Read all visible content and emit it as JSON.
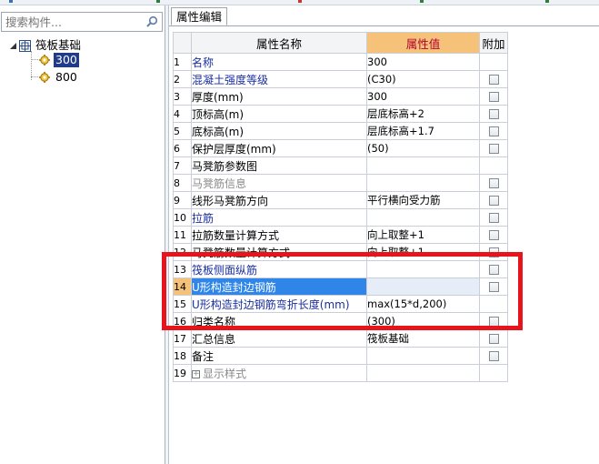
{
  "colors": {
    "value_header_bg": "#f6c27a",
    "value_header_text": "#b1002c",
    "name_blue": "#1a2f9e",
    "name_gray": "#8a8a8a",
    "selection": "#2f86e8",
    "tree_selection": "#1f3b8a",
    "highlight_frame": "#e8141b"
  },
  "search": {
    "placeholder": "搜索构件..."
  },
  "tree": {
    "root": {
      "label": "筏板基础",
      "icon": "grid-icon",
      "expanded": true
    },
    "children": [
      {
        "label": "300",
        "icon": "gear-icon",
        "selected": true
      },
      {
        "label": "800",
        "icon": "gear-icon",
        "selected": false
      }
    ]
  },
  "tabs": [
    {
      "label": "属性编辑",
      "active": true
    }
  ],
  "grid": {
    "headers": {
      "name": "属性名称",
      "value": "属性值",
      "add": "附加"
    },
    "rows": [
      {
        "num": "1",
        "name": "名称",
        "value": "300",
        "style": "blue",
        "checkbox": false
      },
      {
        "num": "2",
        "name": "混凝土强度等级",
        "value": "(C30)",
        "style": "blue",
        "checkbox": true
      },
      {
        "num": "3",
        "name": "厚度(mm)",
        "value": "300",
        "style": "black",
        "checkbox": true
      },
      {
        "num": "4",
        "name": "顶标高(m)",
        "value": "层底标高+2",
        "style": "black",
        "checkbox": true
      },
      {
        "num": "5",
        "name": "底标高(m)",
        "value": "层底标高+1.7",
        "style": "black",
        "checkbox": true
      },
      {
        "num": "6",
        "name": "保护层厚度(mm)",
        "value": "(50)",
        "style": "black",
        "checkbox": true
      },
      {
        "num": "7",
        "name": "马凳筋参数图",
        "value": "",
        "style": "black",
        "checkbox": false
      },
      {
        "num": "8",
        "name": "马凳筋信息",
        "value": "",
        "style": "gray",
        "checkbox": true
      },
      {
        "num": "9",
        "name": "线形马凳筋方向",
        "value": "平行横向受力筋",
        "style": "black",
        "checkbox": true
      },
      {
        "num": "10",
        "name": "拉筋",
        "value": "",
        "style": "blue",
        "checkbox": true
      },
      {
        "num": "11",
        "name": "拉筋数量计算方式",
        "value": "向上取整+1",
        "style": "black",
        "checkbox": true
      },
      {
        "num": "12",
        "name": "马凳筋数量计算方式",
        "value": "向上取整+1",
        "style": "black",
        "checkbox": true
      },
      {
        "num": "13",
        "name": "筏板侧面纵筋",
        "value": "",
        "style": "blue",
        "checkbox": true
      },
      {
        "num": "14",
        "name": "U形构造封边钢筋",
        "value": "",
        "style": "selected",
        "checkbox": true
      },
      {
        "num": "15",
        "name": "U形构造封边钢筋弯折长度(mm)",
        "value": "max(15*d,200)",
        "style": "blue",
        "checkbox": false
      },
      {
        "num": "16",
        "name": "归类名称",
        "value": "(300)",
        "style": "black",
        "checkbox": true
      },
      {
        "num": "17",
        "name": "汇总信息",
        "value": "筏板基础",
        "style": "black",
        "checkbox": true
      },
      {
        "num": "18",
        "name": "备注",
        "value": "",
        "style": "black",
        "checkbox": true
      },
      {
        "num": "19",
        "name": "显示样式",
        "value": "",
        "style": "gray",
        "checkbox": false,
        "expandable": true
      }
    ]
  }
}
